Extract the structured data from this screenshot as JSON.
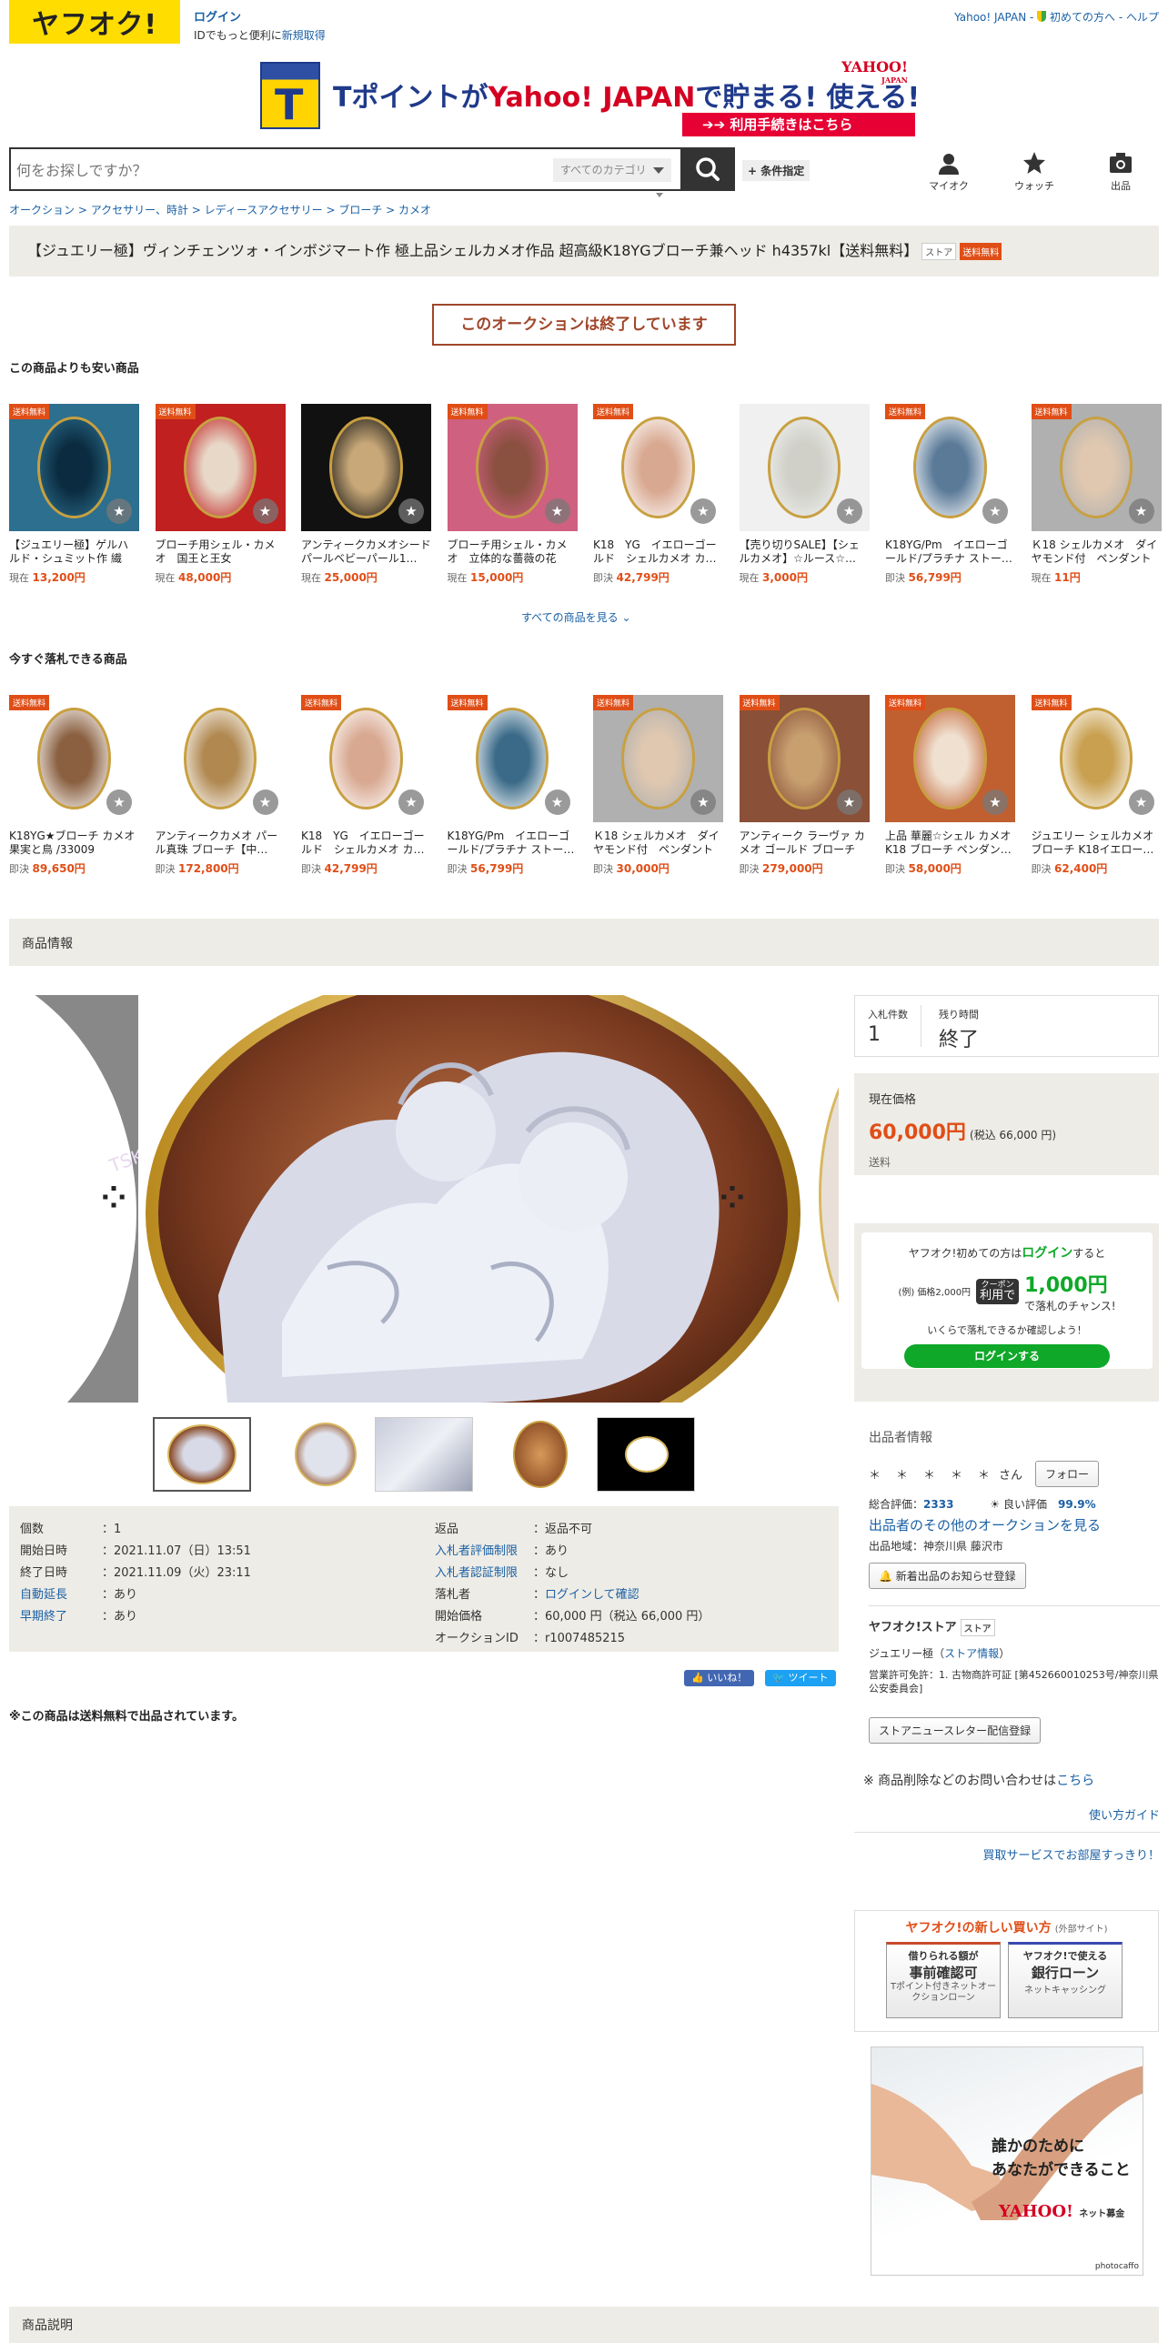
{
  "header": {
    "logo": "ヤフオク!",
    "login_label": "ログイン",
    "login_sub": "IDでもっと便利に",
    "register_label": "新規取得",
    "top_links": [
      "Yahoo! JAPAN",
      "初めての方へ",
      "ヘルプ"
    ]
  },
  "banner": {
    "t_letter": "T",
    "text_a": "Tポイントが",
    "text_b": "Yahoo! JAPAN",
    "text_c": "で",
    "text_d": "貯まる! 使える!",
    "yahoo_logo": "YAHOO!",
    "yahoo_sub": "JAPAN",
    "button": "利用手続きはこちら"
  },
  "search": {
    "placeholder": "何をお探しですか？",
    "category": "すべてのカテゴリ",
    "conditions": "+ 条件指定"
  },
  "header_icons": [
    {
      "label": "マイオク",
      "icon": "person-icon"
    },
    {
      "label": "ウォッチ",
      "icon": "star-icon"
    },
    {
      "label": "出品",
      "icon": "camera-icon"
    }
  ],
  "breadcrumb": [
    "オークション",
    "アクセサリー、時計",
    "レディースアクセサリー",
    "ブローチ",
    "カメオ"
  ],
  "item": {
    "title": "【ジュエリー極】ヴィンチェンツォ・インボジマート作 極上品シェルカメオ作品 超高級K18YGブローチ兼ヘッド h4357kl【送料無料】",
    "store_tag": "ストア",
    "free_tag": "送料無料",
    "ended_msg": "このオークションは終了しています"
  },
  "cheaper": {
    "heading": "この商品よりも安い商品",
    "see_all": "すべての商品を見る",
    "products": [
      {
        "name": "【ジュエリー極】ゲルハルド・シュミット作 繊細…",
        "price_label": "現在",
        "price": "13,200円",
        "free": "送料無料",
        "colors": [
          "#2c6f8e",
          "#0b2c40"
        ]
      },
      {
        "name": "ブローチ用シェル・カメオ　国王と王女",
        "price_label": "現在",
        "price": "48,000円",
        "free": "送料無料",
        "colors": [
          "#c02020",
          "#e8d8c8"
        ]
      },
      {
        "name": "アンティークカメオシードパールベビーパール1…",
        "price_label": "現在",
        "price": "25,000円",
        "free": "",
        "colors": [
          "#111111",
          "#c8a878"
        ]
      },
      {
        "name": "ブローチ用シェル・カメオ　立体的な薔薇の花",
        "price_label": "現在",
        "price": "15,000円",
        "free": "送料無料",
        "colors": [
          "#d06080",
          "#8a5040"
        ]
      },
      {
        "name": "K18　YG　イエローゴールド　シェルカメオ カ…",
        "price_label": "即決",
        "price": "42,799円",
        "free": "送料無料",
        "colors": [
          "#ffffff",
          "#d8a890"
        ]
      },
      {
        "name": "【売り切りSALE】【シェルカメオ】☆ルース☆…",
        "price_label": "現在",
        "price": "3,000円",
        "free": "",
        "colors": [
          "#f0f0f0",
          "#d0d0c8"
        ]
      },
      {
        "name": "K18YG/Pm　イエローゴールド/プラチナ ストー…",
        "price_label": "即決",
        "price": "56,799円",
        "free": "送料無料",
        "colors": [
          "#ffffff",
          "#5a7a98"
        ]
      },
      {
        "name": "Ｋ18 シェルカメオ　ダイヤモンド付　ペンダント",
        "price_label": "現在",
        "price": "11円",
        "free": "送料無料",
        "colors": [
          "#b0b0b0",
          "#e0c8b0"
        ]
      }
    ]
  },
  "buynow": {
    "heading": "今すぐ落札できる商品",
    "products": [
      {
        "name": "K18YG★ブローチ カメオ 果実と鳥 /33009",
        "price_label": "即決",
        "price": "89,650円",
        "free": "送料無料",
        "colors": [
          "#ffffff",
          "#8a6040"
        ]
      },
      {
        "name": "アンティークカメオ パール真珠 ブローチ【中…",
        "price_label": "即決",
        "price": "172,800円",
        "free": "",
        "colors": [
          "#ffffff",
          "#b08850"
        ]
      },
      {
        "name": "K18　YG　イエローゴールド　シェルカメオ カ…",
        "price_label": "即決",
        "price": "42,799円",
        "free": "送料無料",
        "colors": [
          "#ffffff",
          "#d8a890"
        ]
      },
      {
        "name": "K18YG/Pm　イエローゴールド/プラチナ ストー…",
        "price_label": "即決",
        "price": "56,799円",
        "free": "送料無料",
        "colors": [
          "#ffffff",
          "#3a6a88"
        ]
      },
      {
        "name": "Ｋ18 シェルカメオ　ダイヤモンド付　ペンダント",
        "price_label": "即決",
        "price": "30,000円",
        "free": "送料無料",
        "colors": [
          "#b0b0b0",
          "#e0c8b0"
        ]
      },
      {
        "name": "アンティーク ラーヴァ カメオ ゴールド ブローチ",
        "price_label": "即決",
        "price": "279,000円",
        "free": "送料無料",
        "colors": [
          "#8a5038",
          "#c8a070"
        ]
      },
      {
        "name": "上品 華麗☆シェル カメオ K18 ブローチ ペンダン…",
        "price_label": "即決",
        "price": "58,000円",
        "free": "送料無料",
        "colors": [
          "#c06030",
          "#f0e0d0"
        ]
      },
      {
        "name": "ジュエリー シェルカメオ ブローチ K18イエロー…",
        "price_label": "即決",
        "price": "62,400円",
        "free": "送料無料",
        "colors": [
          "#ffffff",
          "#c8a050"
        ]
      }
    ]
  },
  "info": {
    "heading": "商品情報",
    "details_left": [
      {
        "k": "個数",
        "v": "1",
        "link": false
      },
      {
        "k": "開始日時",
        "v": "2021.11.07（日）13:51",
        "link": false
      },
      {
        "k": "終了日時",
        "v": "2021.11.09（火）23:11",
        "link": false
      },
      {
        "k": "自動延長",
        "v": "あり",
        "link": true
      },
      {
        "k": "早期終了",
        "v": "あり",
        "link": true
      }
    ],
    "details_right": [
      {
        "k": "返品",
        "v": "返品不可",
        "link": false,
        "vlink": false
      },
      {
        "k": "入札者評価制限",
        "v": "あり",
        "link": true,
        "vlink": false
      },
      {
        "k": "入札者認証制限",
        "v": "なし",
        "link": true,
        "vlink": false
      },
      {
        "k": "落札者",
        "v": "ログインして確認",
        "link": false,
        "vlink": true
      },
      {
        "k": "開始価格",
        "v": "60,000 円（税込 66,000 円）",
        "link": false,
        "vlink": false
      },
      {
        "k": "オークションID",
        "v": "r1007485215",
        "link": false,
        "vlink": false
      }
    ],
    "like": "いいね！",
    "tweet": "ツイート",
    "free_note": "※この商品は送料無料で出品されています。"
  },
  "bid": {
    "bids_label": "入札件数",
    "bids": "1",
    "time_label": "残り時間",
    "time": "終了",
    "price_label": "現在価格",
    "price": "60,000円",
    "tax": "(税込 66,000 円)",
    "shipping_label": "送料"
  },
  "loginpromo": {
    "line1a": "ヤフオク!初めての方は",
    "line1b": "ログイン",
    "line1c": "すると",
    "example": "(例) 価格2,000円",
    "coupon1": "クーポン",
    "coupon2": "利用で",
    "amount": "1,000円",
    "suffix": "で落札のチャンス!",
    "line3": "いくらで落札できるか確認しよう！",
    "button": "ログインする"
  },
  "seller": {
    "heading": "出品者情報",
    "name": "＊　＊　＊　＊　＊",
    "san": "さん",
    "follow": "フォロー",
    "rating_label": "総合評価：",
    "rating": "2333",
    "good_label": "良い評価",
    "good_pct": "99.9%",
    "other_link": "出品者のその他のオークションを見る",
    "region": "出品地域：神奈川県 藤沢市",
    "notify_btn": "新着出品のお知らせ登録",
    "store_heading": "ヤフオク!ストア",
    "store_tag": "ストア",
    "store_name": "ジュエリー極（",
    "store_info": "ストア情報",
    "store_name_end": "）",
    "license": "営業許可免許：1. 古物商許可証 [第452660010253号/神奈川県公安委員会]",
    "newsletter_btn": "ストアニュースレター配信登録",
    "inquiry": "※ 商品削除などのお問い合わせは",
    "inquiry_link": "こちら",
    "guide": "使い方ガイド",
    "service": "買取サービスでお部屋すっきり！"
  },
  "newbuy": {
    "title": "ヤフオク!の新しい買い方",
    "ext": "(外部サイト)",
    "card1_top": "借りられる額が",
    "card1_main": "事前確認可",
    "card1_sub": "Tポイント付きネットオークションローン",
    "card2_top": "ヤフオク!で使える",
    "card2_main": "銀行ローン",
    "card2_sub": "ネットキャッシング"
  },
  "ad": {
    "line1": "誰かのために",
    "line2": "あなたができること",
    "brand": "YAHOO!",
    "brand_sub": "ネット募金",
    "credit": "photocaffo"
  },
  "desc_heading": "商品説明",
  "colors": {
    "brand_yellow": "#ffdd00",
    "price_orange": "#e04e17",
    "link_blue": "#1a60a5",
    "panel_beige": "#eeece6",
    "login_green": "#0fa829"
  }
}
